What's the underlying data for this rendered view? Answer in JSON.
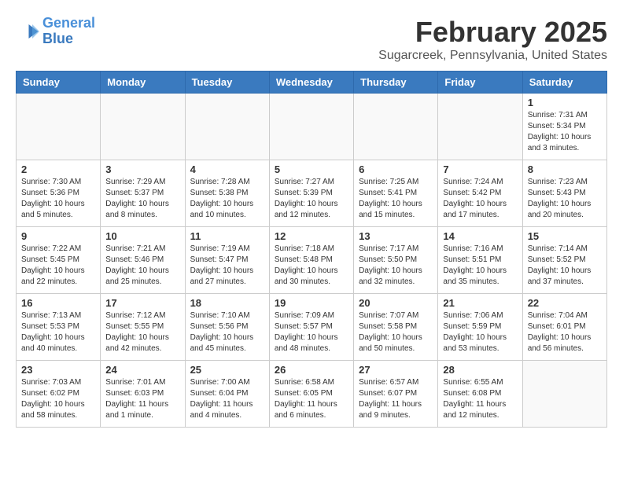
{
  "header": {
    "logo_line1": "General",
    "logo_line2": "Blue",
    "month_title": "February 2025",
    "location": "Sugarcreek, Pennsylvania, United States"
  },
  "weekdays": [
    "Sunday",
    "Monday",
    "Tuesday",
    "Wednesday",
    "Thursday",
    "Friday",
    "Saturday"
  ],
  "weeks": [
    [
      {
        "day": "",
        "info": ""
      },
      {
        "day": "",
        "info": ""
      },
      {
        "day": "",
        "info": ""
      },
      {
        "day": "",
        "info": ""
      },
      {
        "day": "",
        "info": ""
      },
      {
        "day": "",
        "info": ""
      },
      {
        "day": "1",
        "info": "Sunrise: 7:31 AM\nSunset: 5:34 PM\nDaylight: 10 hours\nand 3 minutes."
      }
    ],
    [
      {
        "day": "2",
        "info": "Sunrise: 7:30 AM\nSunset: 5:36 PM\nDaylight: 10 hours\nand 5 minutes."
      },
      {
        "day": "3",
        "info": "Sunrise: 7:29 AM\nSunset: 5:37 PM\nDaylight: 10 hours\nand 8 minutes."
      },
      {
        "day": "4",
        "info": "Sunrise: 7:28 AM\nSunset: 5:38 PM\nDaylight: 10 hours\nand 10 minutes."
      },
      {
        "day": "5",
        "info": "Sunrise: 7:27 AM\nSunset: 5:39 PM\nDaylight: 10 hours\nand 12 minutes."
      },
      {
        "day": "6",
        "info": "Sunrise: 7:25 AM\nSunset: 5:41 PM\nDaylight: 10 hours\nand 15 minutes."
      },
      {
        "day": "7",
        "info": "Sunrise: 7:24 AM\nSunset: 5:42 PM\nDaylight: 10 hours\nand 17 minutes."
      },
      {
        "day": "8",
        "info": "Sunrise: 7:23 AM\nSunset: 5:43 PM\nDaylight: 10 hours\nand 20 minutes."
      }
    ],
    [
      {
        "day": "9",
        "info": "Sunrise: 7:22 AM\nSunset: 5:45 PM\nDaylight: 10 hours\nand 22 minutes."
      },
      {
        "day": "10",
        "info": "Sunrise: 7:21 AM\nSunset: 5:46 PM\nDaylight: 10 hours\nand 25 minutes."
      },
      {
        "day": "11",
        "info": "Sunrise: 7:19 AM\nSunset: 5:47 PM\nDaylight: 10 hours\nand 27 minutes."
      },
      {
        "day": "12",
        "info": "Sunrise: 7:18 AM\nSunset: 5:48 PM\nDaylight: 10 hours\nand 30 minutes."
      },
      {
        "day": "13",
        "info": "Sunrise: 7:17 AM\nSunset: 5:50 PM\nDaylight: 10 hours\nand 32 minutes."
      },
      {
        "day": "14",
        "info": "Sunrise: 7:16 AM\nSunset: 5:51 PM\nDaylight: 10 hours\nand 35 minutes."
      },
      {
        "day": "15",
        "info": "Sunrise: 7:14 AM\nSunset: 5:52 PM\nDaylight: 10 hours\nand 37 minutes."
      }
    ],
    [
      {
        "day": "16",
        "info": "Sunrise: 7:13 AM\nSunset: 5:53 PM\nDaylight: 10 hours\nand 40 minutes."
      },
      {
        "day": "17",
        "info": "Sunrise: 7:12 AM\nSunset: 5:55 PM\nDaylight: 10 hours\nand 42 minutes."
      },
      {
        "day": "18",
        "info": "Sunrise: 7:10 AM\nSunset: 5:56 PM\nDaylight: 10 hours\nand 45 minutes."
      },
      {
        "day": "19",
        "info": "Sunrise: 7:09 AM\nSunset: 5:57 PM\nDaylight: 10 hours\nand 48 minutes."
      },
      {
        "day": "20",
        "info": "Sunrise: 7:07 AM\nSunset: 5:58 PM\nDaylight: 10 hours\nand 50 minutes."
      },
      {
        "day": "21",
        "info": "Sunrise: 7:06 AM\nSunset: 5:59 PM\nDaylight: 10 hours\nand 53 minutes."
      },
      {
        "day": "22",
        "info": "Sunrise: 7:04 AM\nSunset: 6:01 PM\nDaylight: 10 hours\nand 56 minutes."
      }
    ],
    [
      {
        "day": "23",
        "info": "Sunrise: 7:03 AM\nSunset: 6:02 PM\nDaylight: 10 hours\nand 58 minutes."
      },
      {
        "day": "24",
        "info": "Sunrise: 7:01 AM\nSunset: 6:03 PM\nDaylight: 11 hours\nand 1 minute."
      },
      {
        "day": "25",
        "info": "Sunrise: 7:00 AM\nSunset: 6:04 PM\nDaylight: 11 hours\nand 4 minutes."
      },
      {
        "day": "26",
        "info": "Sunrise: 6:58 AM\nSunset: 6:05 PM\nDaylight: 11 hours\nand 6 minutes."
      },
      {
        "day": "27",
        "info": "Sunrise: 6:57 AM\nSunset: 6:07 PM\nDaylight: 11 hours\nand 9 minutes."
      },
      {
        "day": "28",
        "info": "Sunrise: 6:55 AM\nSunset: 6:08 PM\nDaylight: 11 hours\nand 12 minutes."
      },
      {
        "day": "",
        "info": ""
      }
    ]
  ]
}
